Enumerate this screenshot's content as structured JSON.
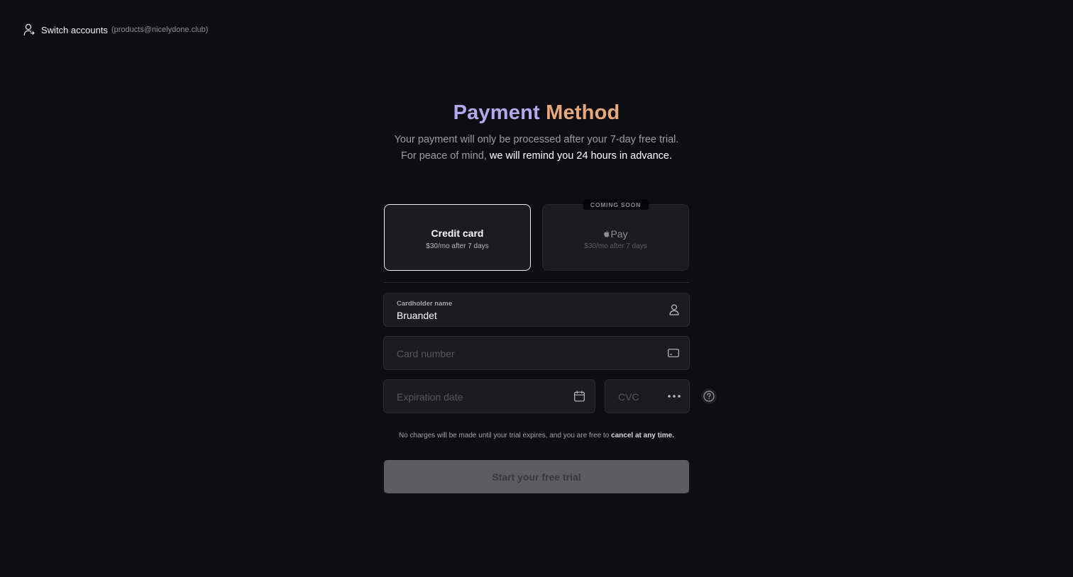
{
  "account": {
    "switch_label": "Switch accounts",
    "email": "(products@nicelydone.club)",
    "icon": "user-switch-icon"
  },
  "header": {
    "title_part1": "Payment",
    "title_part2": "Method",
    "subtitle_line1": "Your payment will only be processed after your 7-day free trial.",
    "subtitle_line2_plain": "For peace of mind,",
    "subtitle_line2_highlight": "we will remind you 24 hours in advance.",
    "colors": {
      "title_part1": "#b3a7ee",
      "title_part2": "#e8a87c"
    }
  },
  "methods": [
    {
      "title": "Credit card",
      "subtitle": "$30/mo after 7 days",
      "selected": true
    },
    {
      "title": "Pay",
      "brand_icon": "apple-icon",
      "subtitle": "$30/mo after 7 days",
      "badge": "COMING SOON",
      "disabled": true
    }
  ],
  "form": {
    "cardholder": {
      "label": "Cardholder name",
      "value": "Bruandet",
      "icon": "user-icon"
    },
    "card_number": {
      "placeholder": "Card number",
      "icon": "credit-card-icon"
    },
    "expiration": {
      "placeholder": "Expiration date",
      "icon": "calendar-icon"
    },
    "cvc": {
      "placeholder": "CVC",
      "icon": "dots-icon"
    },
    "help_icon": "question-circle-icon"
  },
  "notice": {
    "text": "No charges will be made until your trial expires, and you are free to",
    "bold": "cancel at any time."
  },
  "cta": {
    "label": "Start your free trial",
    "enabled": false
  }
}
